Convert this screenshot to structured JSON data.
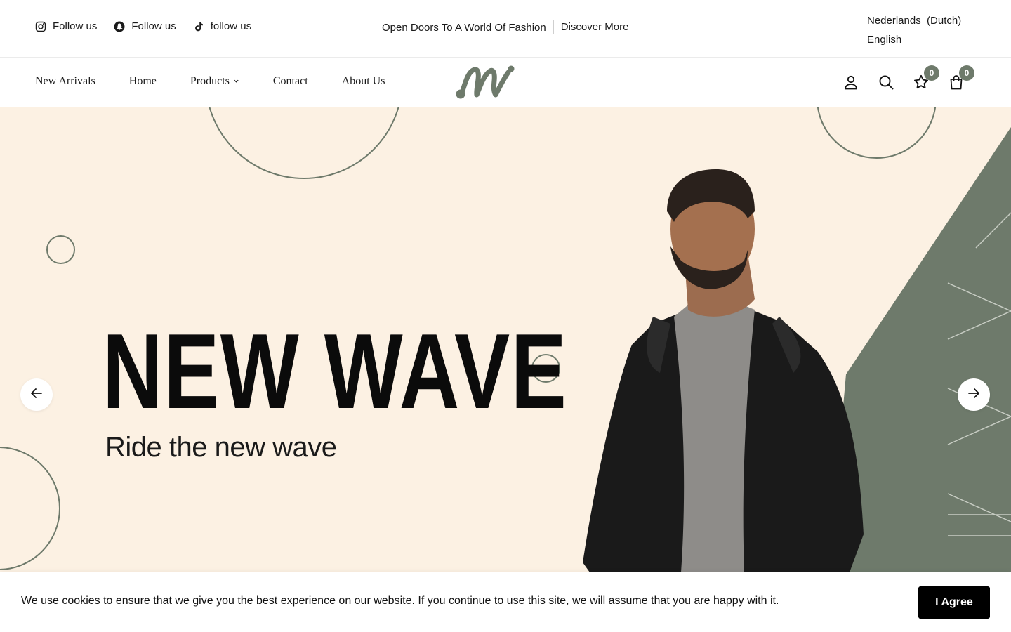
{
  "topbar": {
    "social": [
      {
        "icon": "instagram-icon",
        "label": "Follow us"
      },
      {
        "icon": "snapchat-icon",
        "label": "Follow us"
      },
      {
        "icon": "tiktok-icon",
        "label": "follow us"
      }
    ],
    "promo_text": "Open Doors To A World Of Fashion",
    "promo_link": "Discover More",
    "languages": [
      "Nederlands  (Dutch)",
      "English"
    ]
  },
  "nav": {
    "links": [
      "New Arrivals",
      "Home",
      "Products",
      "Contact",
      "About Us"
    ],
    "wishlist_count": "0",
    "cart_count": "0"
  },
  "hero": {
    "title": "NEW WAVE",
    "subtitle": "Ride the new wave"
  },
  "cookie": {
    "message": "We use cookies to ensure that we give you the best experience on our website. If you continue to use this site, we will assume that you are happy with it.",
    "button_label": "I Agree"
  },
  "colors": {
    "accent": "#6e7a6b",
    "hero_bg": "#fcf1e3",
    "text": "#111111"
  }
}
